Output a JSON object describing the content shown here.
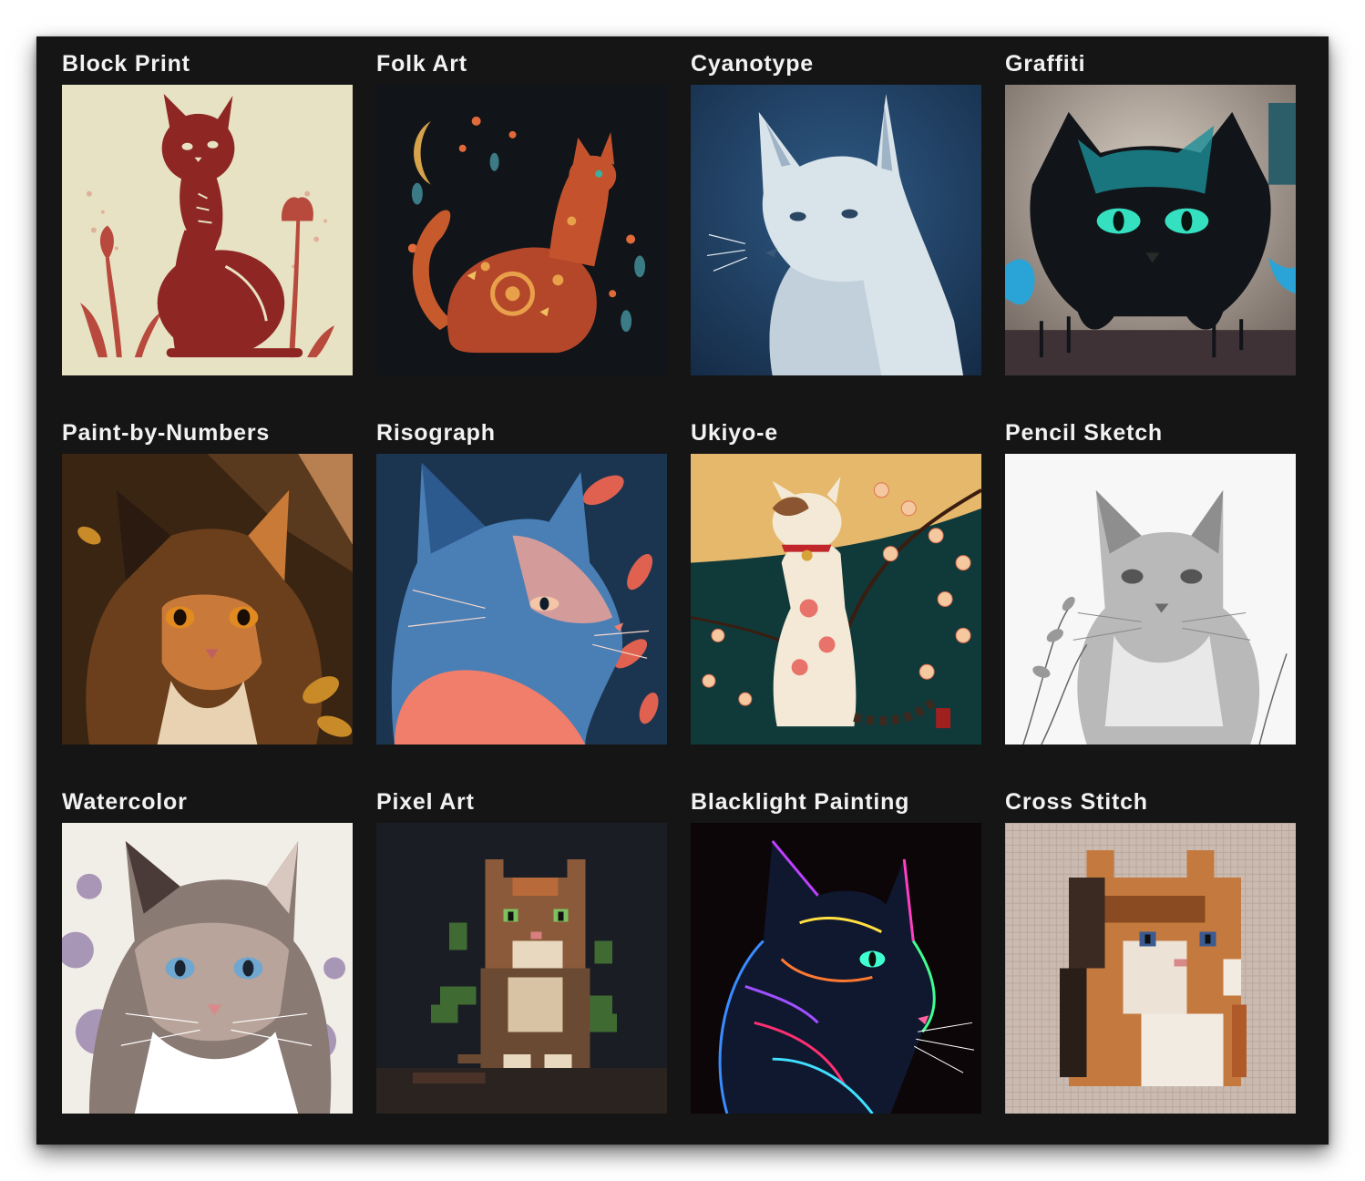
{
  "gallery": {
    "items": [
      {
        "title": "Block Print",
        "bg": "#e8e2c4",
        "accent": "#9c2f2a",
        "icon": "block-print-cat-image"
      },
      {
        "title": "Folk Art",
        "bg": "#111418",
        "accent": "#d0592a",
        "icon": "folk-art-cat-image"
      },
      {
        "title": "Cyanotype",
        "bg": "#1f3a5c",
        "accent": "#d9e3ea",
        "icon": "cyanotype-cat-image"
      },
      {
        "title": "Graffiti",
        "bg": "#4a4340",
        "accent": "#1fb7b0",
        "icon": "graffiti-cat-image"
      },
      {
        "title": "Paint-by-Numbers",
        "bg": "#3a2412",
        "accent": "#d08a3e",
        "icon": "paint-by-numbers-cat-image"
      },
      {
        "title": "Risograph",
        "bg": "#1b3550",
        "accent": "#f07e6b",
        "icon": "risograph-cat-image"
      },
      {
        "title": "Ukiyo-e",
        "bg": "#e6b86b",
        "accent": "#10393a",
        "icon": "ukiyo-e-cat-image"
      },
      {
        "title": "Pencil Sketch",
        "bg": "#f4f4f4",
        "accent": "#7a7a7a",
        "icon": "pencil-sketch-cat-image"
      },
      {
        "title": "Watercolor",
        "bg": "#efece6",
        "accent": "#6d4f8e",
        "icon": "watercolor-cat-image"
      },
      {
        "title": "Pixel Art",
        "bg": "#1a1d24",
        "accent": "#b86a3a",
        "icon": "pixel-art-cat-image"
      },
      {
        "title": "Blacklight Painting",
        "bg": "#0c0608",
        "accent": "#3a8cff",
        "icon": "blacklight-painting-cat-image"
      },
      {
        "title": "Cross Stitch",
        "bg": "#c9b8ad",
        "accent": "#b5652f",
        "icon": "cross-stitch-cat-image"
      }
    ]
  }
}
